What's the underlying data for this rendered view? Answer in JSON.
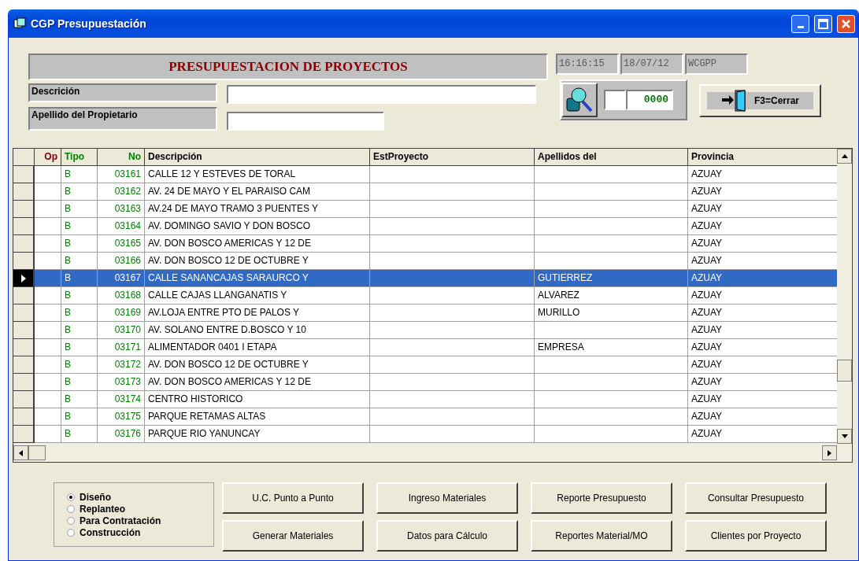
{
  "window": {
    "title": "CGP Presupuestación"
  },
  "header": {
    "title": "PRESUPUESTACION DE PROYECTOS",
    "time": "16:16:15",
    "date": "18/07/12",
    "user": "WCGPP"
  },
  "filters": [
    {
      "label": "Descrición"
    },
    {
      "label": "Apellido del Propietario"
    }
  ],
  "counter": {
    "value": "0000"
  },
  "close_button": "F3=Cerrar",
  "table": {
    "columns": [
      {
        "label": "Op",
        "kind": "op"
      },
      {
        "label": "Tipo",
        "kind": "green"
      },
      {
        "label": "No",
        "kind": "num"
      },
      {
        "label": "Descripción",
        "kind": "text"
      },
      {
        "label": "EstProyecto",
        "kind": "text"
      },
      {
        "label": "Apellidos del",
        "kind": "text"
      },
      {
        "label": "Provincia",
        "kind": "text"
      }
    ],
    "rows": [
      {
        "selected": false,
        "cells": [
          "",
          "B",
          "03161",
          "CALLE 12 Y ESTEVES DE TORAL",
          "",
          "",
          "AZUAY"
        ]
      },
      {
        "selected": false,
        "cells": [
          "",
          "B",
          "03162",
          "AV. 24 DE MAYO Y EL PARAISO CAM",
          "",
          "",
          "AZUAY"
        ]
      },
      {
        "selected": false,
        "cells": [
          "",
          "B",
          "03163",
          "AV.24 DE MAYO TRAMO 3 PUENTES Y",
          "",
          "",
          "AZUAY"
        ]
      },
      {
        "selected": false,
        "cells": [
          "",
          "B",
          "03164",
          "AV. DOMINGO SAVIO Y DON BOSCO",
          "",
          "",
          "AZUAY"
        ]
      },
      {
        "selected": false,
        "cells": [
          "",
          "B",
          "03165",
          "AV. DON BOSCO AMERICAS Y 12 DE",
          "",
          "",
          "AZUAY"
        ]
      },
      {
        "selected": false,
        "cells": [
          "",
          "B",
          "03166",
          "AV. DON BOSCO 12 DE OCTUBRE Y",
          "",
          "",
          "AZUAY"
        ]
      },
      {
        "selected": true,
        "cells": [
          "",
          "B",
          "03167",
          "CALLE SANANCAJAS SARAURCO Y",
          "",
          "GUTIERREZ",
          "AZUAY"
        ]
      },
      {
        "selected": false,
        "cells": [
          "",
          "B",
          "03168",
          "CALLE CAJAS LLANGANATIS Y",
          "",
          "ALVAREZ",
          "AZUAY"
        ]
      },
      {
        "selected": false,
        "cells": [
          "",
          "B",
          "03169",
          "AV.LOJA ENTRE PTO DE PALOS Y",
          "",
          "MURILLO",
          "AZUAY"
        ]
      },
      {
        "selected": false,
        "cells": [
          "",
          "B",
          "03170",
          "AV. SOLANO ENTRE D.BOSCO Y 10",
          "",
          "",
          "AZUAY"
        ]
      },
      {
        "selected": false,
        "cells": [
          "",
          "B",
          "03171",
          "ALIMENTADOR 0401 I ETAPA",
          "",
          "EMPRESA",
          "AZUAY"
        ]
      },
      {
        "selected": false,
        "cells": [
          "",
          "B",
          "03172",
          "AV. DON BOSCO 12 DE OCTUBRE Y",
          "",
          "",
          "AZUAY"
        ]
      },
      {
        "selected": false,
        "cells": [
          "",
          "B",
          "03173",
          "AV. DON BOSCO AMERICAS Y 12 DE",
          "",
          "",
          "AZUAY"
        ]
      },
      {
        "selected": false,
        "cells": [
          "",
          "B",
          "03174",
          "CENTRO HISTORICO",
          "",
          "",
          "AZUAY"
        ]
      },
      {
        "selected": false,
        "cells": [
          "",
          "B",
          "03175",
          "PARQUE RETAMAS ALTAS",
          "",
          "",
          "AZUAY"
        ]
      },
      {
        "selected": false,
        "cells": [
          "",
          "B",
          "03176",
          "PARQUE RIO YANUNCAY",
          "",
          "",
          "AZUAY"
        ]
      }
    ]
  },
  "stages": [
    {
      "label": "Diseño",
      "selected": true
    },
    {
      "label": "Replanteo",
      "selected": false
    },
    {
      "label": "Para Contratación",
      "selected": false
    },
    {
      "label": "Construcción",
      "selected": false
    }
  ],
  "buttons": [
    [
      "U.C. Punto a Punto",
      "Generar Materiales"
    ],
    [
      "Ingreso Materiales",
      "Datos para Cálculo"
    ],
    [
      "Reporte Presupuesto",
      "Reportes Material/MO"
    ],
    [
      "Consultar Presupuesto",
      "Clientes por Proyecto"
    ]
  ]
}
